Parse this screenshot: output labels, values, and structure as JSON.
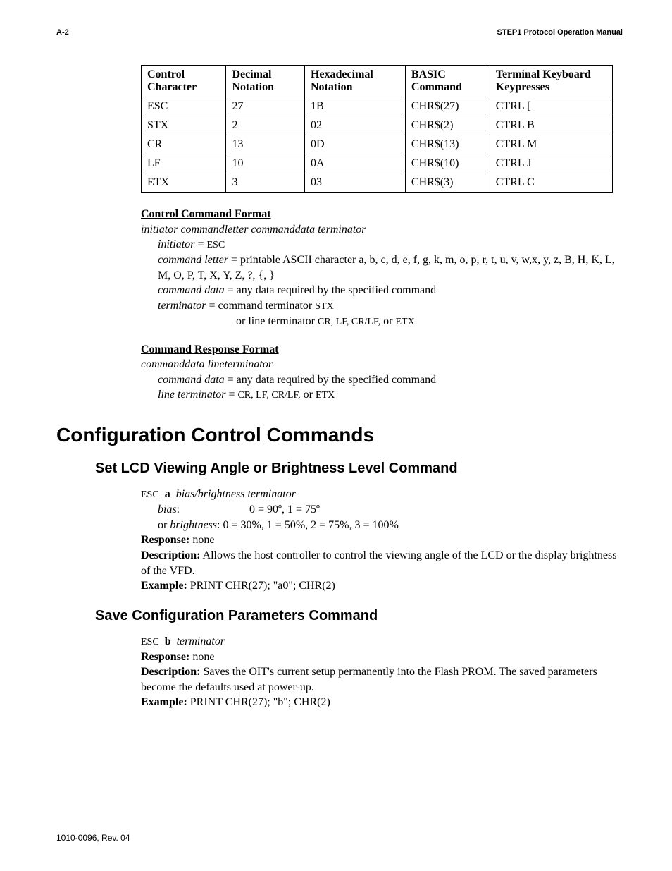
{
  "header": {
    "left": "A-2",
    "right": "STEP1 Protocol Operation Manual"
  },
  "table": {
    "headers": [
      "Control Character",
      "Decimal Notation",
      "Hexadecimal Notation",
      "BASIC Command",
      "Terminal Keyboard Keypresses"
    ],
    "rows": [
      [
        "ESC",
        "27",
        "1B",
        "CHR$(27)",
        "CTRL ["
      ],
      [
        "STX",
        "2",
        "02",
        "CHR$(2)",
        "CTRL B"
      ],
      [
        "CR",
        "13",
        "0D",
        "CHR$(13)",
        "CTRL M"
      ],
      [
        "LF",
        "10",
        "0A",
        "CHR$(10)",
        "CTRL J"
      ],
      [
        "ETX",
        "3",
        "03",
        "CHR$(3)",
        "CTRL C"
      ]
    ]
  },
  "ccf": {
    "title": "Control Command Format",
    "syntax": "initiator  commandletter  commanddata  terminator",
    "initiator_label": "initiator",
    "initiator_eq": " = ",
    "initiator_val": "ESC",
    "cmdletter_label": "command letter",
    "cmdletter_text": " = printable ASCII character a, b, c, d, e, f, g, k, m, o, p, r, t, u, v, w,x, y, z, B, H, K, L, M, O, P, T, X, Y, Z, ?, {, }",
    "cmddata_label": "command data",
    "cmddata_text": " = any data required by the specified command",
    "term_label": "terminator",
    "term_text1": " =   command terminator ",
    "term_val1": "STX",
    "term_text2": "or line terminator ",
    "term_val2": "CR, LF, CR/LF,",
    "term_text3": " or ",
    "term_val3": "ETX"
  },
  "crf": {
    "title": "Command Response Format",
    "syntax": "commanddata  lineterminator",
    "cmddata_label": "command data",
    "cmddata_text": " = any data required by the specified command",
    "lineterm_label": "line terminator",
    "lineterm_eq": " = ",
    "lineterm_vals": "CR, LF, CR/LF,",
    "lineterm_or": " or ",
    "lineterm_last": "ETX"
  },
  "h1": "Configuration Control Commands",
  "cmd1": {
    "title": "Set LCD Viewing Angle or Brightness Level Command",
    "esc": "ESC",
    "letter": "a",
    "args": "bias/brightness  terminator",
    "bias_label": "bias",
    "bias_colon": ":",
    "bias_vals": "0 = 90º, 1 = 75º",
    "bright_or": "or ",
    "bright_label": "brightness",
    "bright_vals": ":  0 = 30%, 1 = 50%, 2 = 75%, 3 = 100%",
    "resp_label": "Response:",
    "resp_val": "  none",
    "desc_label": "Description:",
    "desc_text": "  Allows the host controller to control the viewing angle of the LCD or the display brightness of the VFD.",
    "ex_label": "Example:",
    "ex_text": "  PRINT CHR(27); \"a0\"; CHR(2)"
  },
  "cmd2": {
    "title": "Save Configuration Parameters Command",
    "esc": "ESC",
    "letter": "b",
    "args": "terminator",
    "resp_label": "Response:",
    "resp_val": "  none",
    "desc_label": "Description:",
    "desc_text": "  Saves the OIT's current setup permanently into the Flash PROM. The saved parameters become the defaults used at power-up.",
    "ex_label": "Example:",
    "ex_text": "  PRINT CHR(27); \"b\"; CHR(2)"
  },
  "footer": "1010-0096, Rev. 04"
}
